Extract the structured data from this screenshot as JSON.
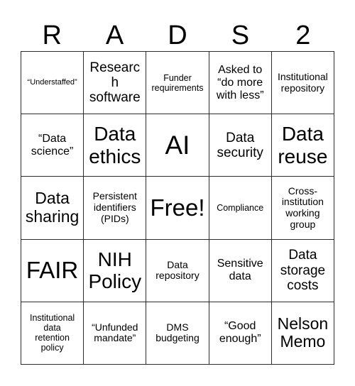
{
  "card": {
    "title_letters": [
      "R",
      "A",
      "D",
      "S",
      "2"
    ],
    "columns": 5,
    "rows": 5,
    "colors": {
      "background": "#ffffff",
      "cell_background": "#ffffff",
      "border": "#2b2b2b",
      "text": "#000000"
    },
    "cells": [
      {
        "text": "“Understaffed”",
        "size": "fs-xxs",
        "row": 1,
        "col": 1
      },
      {
        "text": "Research\nsoftware",
        "size": "fs-l",
        "row": 1,
        "col": 2
      },
      {
        "text": "Funder\nrequirements",
        "size": "fs-xs",
        "row": 1,
        "col": 3
      },
      {
        "text": "Asked to\n“do more\nwith less”",
        "size": "fs-m",
        "row": 1,
        "col": 4
      },
      {
        "text": "Institutional\nrepository",
        "size": "fs-s",
        "row": 1,
        "col": 5
      },
      {
        "text": "“Data\nscience”",
        "size": "fs-m",
        "row": 2,
        "col": 1
      },
      {
        "text": "Data\nethics",
        "size": "fs-xxl",
        "row": 2,
        "col": 2
      },
      {
        "text": "AI",
        "size": "fs-mega",
        "row": 2,
        "col": 3
      },
      {
        "text": "Data\nsecurity",
        "size": "fs-l",
        "row": 2,
        "col": 4
      },
      {
        "text": "Data\nreuse",
        "size": "fs-xxl",
        "row": 2,
        "col": 5
      },
      {
        "text": "Data\nsharing",
        "size": "fs-xl",
        "row": 3,
        "col": 1
      },
      {
        "text": "Persistent\nidentifiers\n(PIDs)",
        "size": "fs-s",
        "row": 3,
        "col": 2
      },
      {
        "text": "Free!",
        "size": "fs-huge",
        "row": 3,
        "col": 3
      },
      {
        "text": "Compliance",
        "size": "fs-xs",
        "row": 3,
        "col": 4
      },
      {
        "text": "Cross-\ninstitution\nworking\ngroup",
        "size": "fs-s",
        "row": 3,
        "col": 5
      },
      {
        "text": "FAIR",
        "size": "fs-huge",
        "row": 4,
        "col": 1
      },
      {
        "text": "NIH\nPolicy",
        "size": "fs-xxl",
        "row": 4,
        "col": 2
      },
      {
        "text": "Data\nrepository",
        "size": "fs-s",
        "row": 4,
        "col": 3
      },
      {
        "text": "Sensitive\ndata",
        "size": "fs-m",
        "row": 4,
        "col": 4
      },
      {
        "text": "Data\nstorage\ncosts",
        "size": "fs-l",
        "row": 4,
        "col": 5
      },
      {
        "text": "Institutional\ndata\nretention\npolicy",
        "size": "fs-xs",
        "row": 5,
        "col": 1
      },
      {
        "text": "“Unfunded\nmandate”",
        "size": "fs-s",
        "row": 5,
        "col": 2
      },
      {
        "text": "DMS\nbudgeting",
        "size": "fs-s",
        "row": 5,
        "col": 3
      },
      {
        "text": "“Good\nenough”",
        "size": "fs-m",
        "row": 5,
        "col": 4
      },
      {
        "text": "Nelson\nMemo",
        "size": "fs-xl",
        "row": 5,
        "col": 5
      }
    ]
  }
}
